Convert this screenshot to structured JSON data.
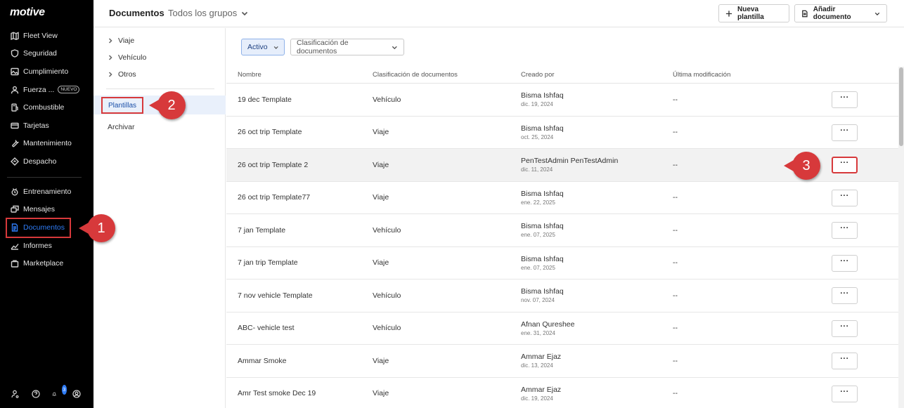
{
  "brand": {
    "logo": "motive"
  },
  "sidebar": {
    "items_top": [
      {
        "label": "Fleet View",
        "icon": "map-icon"
      },
      {
        "label": "Seguridad",
        "icon": "shield-icon"
      },
      {
        "label": "Cumplimiento",
        "icon": "image-icon"
      },
      {
        "label": "Fuerza ...",
        "icon": "user-icon",
        "badge": "NUEVO"
      },
      {
        "label": "Combustible",
        "icon": "fuel-icon"
      },
      {
        "label": "Tarjetas",
        "icon": "card-icon"
      },
      {
        "label": "Mantenimiento",
        "icon": "wrench-icon"
      },
      {
        "label": "Despacho",
        "icon": "dispatch-icon"
      }
    ],
    "items_bottom": [
      {
        "label": "Entrenamiento",
        "icon": "training-icon"
      },
      {
        "label": "Mensajes",
        "icon": "messages-icon"
      },
      {
        "label": "Documentos",
        "icon": "document-icon",
        "active": true
      },
      {
        "label": "Informes",
        "icon": "chart-icon"
      },
      {
        "label": "Marketplace",
        "icon": "bag-icon"
      }
    ],
    "notification_count": "3"
  },
  "header": {
    "title": "Documentos",
    "group_selector": "Todos los grupos",
    "new_template_button": "Nueva plantilla",
    "add_document_button": "Añadir documento"
  },
  "panel": {
    "categories": [
      "Viaje",
      "Vehículo",
      "Otros"
    ],
    "templates": "Plantillas",
    "archive": "Archivar"
  },
  "filters": {
    "status": "Activo",
    "classification": "Clasificación de documentos"
  },
  "table": {
    "columns": [
      "Nombre",
      "Clasificación de documentos",
      "Creado por",
      "Última modificación"
    ],
    "rows": [
      {
        "name": "19 dec Template",
        "classification": "Vehículo",
        "creator": "Bisma Ishfaq",
        "date": "dic. 19, 2024",
        "modified": "--"
      },
      {
        "name": "26 oct trip Template",
        "classification": "Viaje",
        "creator": "Bisma Ishfaq",
        "date": "oct. 25, 2024",
        "modified": "--"
      },
      {
        "name": "26 oct trip Template 2",
        "classification": "Viaje",
        "creator": "PenTestAdmin PenTestAdmin",
        "date": "dic. 11, 2024",
        "modified": "--"
      },
      {
        "name": "26 oct trip Template77",
        "classification": "Viaje",
        "creator": "Bisma Ishfaq",
        "date": "ene. 22, 2025",
        "modified": "--"
      },
      {
        "name": "7 jan Template",
        "classification": "Vehículo",
        "creator": "Bisma Ishfaq",
        "date": "ene. 07, 2025",
        "modified": "--"
      },
      {
        "name": "7 jan trip Template",
        "classification": "Viaje",
        "creator": "Bisma Ishfaq",
        "date": "ene. 07, 2025",
        "modified": "--"
      },
      {
        "name": "7 nov vehicle Template",
        "classification": "Vehículo",
        "creator": "Bisma Ishfaq",
        "date": "nov. 07, 2024",
        "modified": "--"
      },
      {
        "name": "ABC- vehicle test",
        "classification": "Vehículo",
        "creator": "Afnan Qureshee",
        "date": "ene. 31, 2024",
        "modified": "--"
      },
      {
        "name": "Ammar Smoke",
        "classification": "Viaje",
        "creator": "Ammar Ejaz",
        "date": "dic. 13, 2024",
        "modified": "--"
      },
      {
        "name": "Amr Test smoke Dec 19",
        "classification": "Viaje",
        "creator": "Ammar Ejaz",
        "date": "dic. 19, 2024",
        "modified": "--"
      }
    ],
    "more_label": "···"
  },
  "callouts": {
    "one": "1",
    "two": "2",
    "three": "3"
  },
  "colors": {
    "accent": "#2f7cf6",
    "callout": "#d7393b",
    "sidebar_bg": "#000000"
  }
}
